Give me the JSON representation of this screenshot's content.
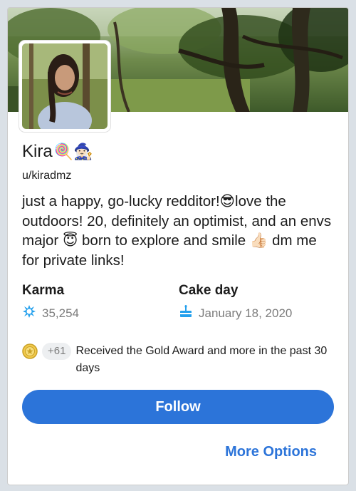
{
  "profile": {
    "display_name": "Kira",
    "name_emojis": "🍭🧙🏻‍♀️",
    "username": "u/kiradmz",
    "bio": "just a happy, go-lucky redditor!😎love the outdoors! 20, definitely an optimist, and an envs major 😇 born to explore and smile 👍🏻 dm me for private links!"
  },
  "stats": {
    "karma_label": "Karma",
    "karma_value": "35,254",
    "cakeday_label": "Cake day",
    "cakeday_value": "January 18, 2020"
  },
  "awards": {
    "count": "+61",
    "text": "Received the Gold Award and more in the past 30 days"
  },
  "actions": {
    "follow_label": "Follow",
    "more_options_label": "More Options"
  },
  "colors": {
    "accent": "#2c74d9",
    "karma_icon": "#24a0ed",
    "muted_text": "#7c7c7c"
  },
  "icons": {
    "karma": "karma-icon",
    "cakeday": "cake-icon",
    "award": "gold-award-icon"
  }
}
